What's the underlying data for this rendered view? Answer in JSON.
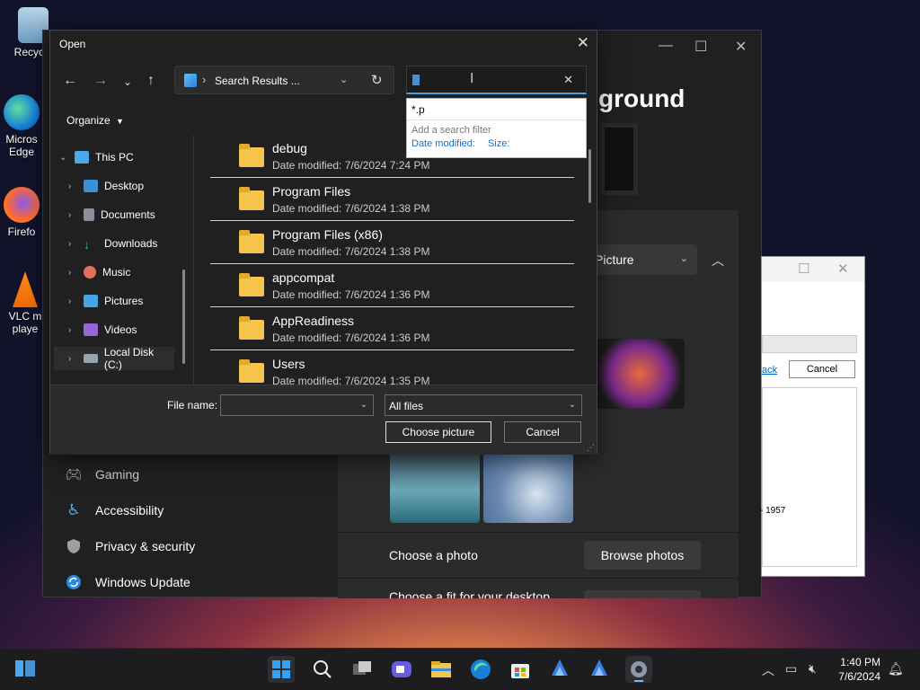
{
  "desktop": {
    "icons": [
      {
        "label": "Recycle"
      },
      {
        "label": "Micros Edge"
      },
      {
        "label": "Firefo"
      },
      {
        "label": "VLC m playe"
      }
    ]
  },
  "settings": {
    "heading_fragment": "ground",
    "select_value": "Picture",
    "nav": [
      {
        "label": "Gaming"
      },
      {
        "label": "Accessibility"
      },
      {
        "label": "Privacy & security"
      },
      {
        "label": "Windows Update"
      }
    ],
    "choose_photo_label": "Choose a photo",
    "browse_photos_label": "Browse photos",
    "choose_fit_label": "Choose a fit for your desktop"
  },
  "white_dialog": {
    "link_fragment": "ack",
    "cancel_label": "Cancel",
    "list_item": "- 1957"
  },
  "open_dialog": {
    "title": "Open",
    "address": "Search Results ...",
    "search_value": "",
    "suggestion": "*.p",
    "add_filter_label": "Add a search filter",
    "filters": [
      "Date modified:",
      "Size:"
    ],
    "organize_label": "Organize",
    "tree": [
      {
        "label": "This PC",
        "color": "#4aa8e8"
      },
      {
        "label": "Desktop",
        "color": "#3b8fd9"
      },
      {
        "label": "Documents",
        "color": "#8a8f99"
      },
      {
        "label": "Downloads",
        "color": "#3bb06a"
      },
      {
        "label": "Music",
        "color": "#e0705a"
      },
      {
        "label": "Pictures",
        "color": "#45a6e6"
      },
      {
        "label": "Videos",
        "color": "#9b63d9"
      },
      {
        "label": "Local Disk (C:)",
        "color": "#9aa4b0"
      }
    ],
    "files": [
      {
        "name": "debug",
        "date": "Date modified: 7/6/2024 7:24 PM"
      },
      {
        "name": "Program Files",
        "date": "Date modified: 7/6/2024 1:38 PM"
      },
      {
        "name": "Program Files (x86)",
        "date": "Date modified: 7/6/2024 1:38 PM"
      },
      {
        "name": "appcompat",
        "date": "Date modified: 7/6/2024 1:36 PM"
      },
      {
        "name": "AppReadiness",
        "date": "Date modified: 7/6/2024 1:36 PM"
      },
      {
        "name": "Users",
        "date": "Date modified: 7/6/2024 1:35 PM"
      }
    ],
    "file_name_label": "File name:",
    "file_name_value": "",
    "file_type": "All files",
    "choose_label": "Choose picture",
    "cancel_label": "Cancel"
  },
  "taskbar": {
    "time": "1:40 PM",
    "date": "7/6/2024",
    "apps": [
      "start-icon",
      "search-icon",
      "task-view-icon",
      "chat-icon",
      "file-explorer-icon",
      "edge-icon",
      "store-icon",
      "app-icon",
      "app-icon",
      "settings-icon"
    ]
  }
}
